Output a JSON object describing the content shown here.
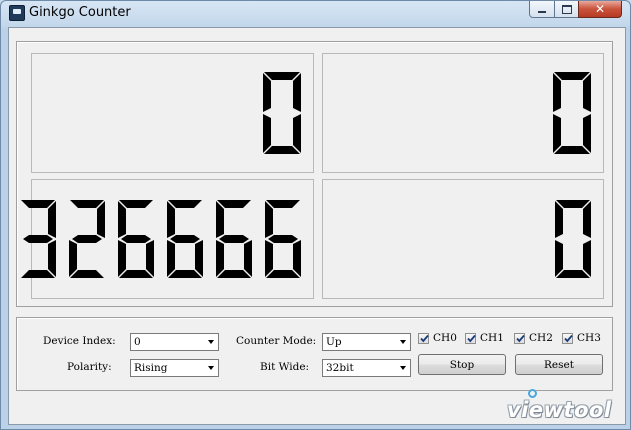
{
  "window": {
    "title": "Ginkgo Counter",
    "close_symbol": "✕"
  },
  "counters": [
    {
      "id": "counter-1",
      "value": "0"
    },
    {
      "id": "counter-2",
      "value": "0"
    },
    {
      "id": "counter-3",
      "value": "326666"
    },
    {
      "id": "counter-4",
      "value": "0"
    }
  ],
  "controls": {
    "device_index_label": "Device Index:",
    "device_index_value": "0",
    "polarity_label": "Polarity:",
    "polarity_value": "Rising",
    "counter_mode_label": "Counter Mode:",
    "counter_mode_value": "Up",
    "bit_wide_label": "Bit Wide:",
    "bit_wide_value": "32bit",
    "channels": [
      {
        "label": "CH0",
        "checked": true
      },
      {
        "label": "CH1",
        "checked": true
      },
      {
        "label": "CH2",
        "checked": true
      },
      {
        "label": "CH3",
        "checked": true
      }
    ],
    "stop_label": "Stop",
    "reset_label": "Reset"
  },
  "watermark": {
    "text": "viewtool"
  },
  "colors": {
    "digit": "#000000",
    "watermark_accent": "#4aa6de"
  }
}
